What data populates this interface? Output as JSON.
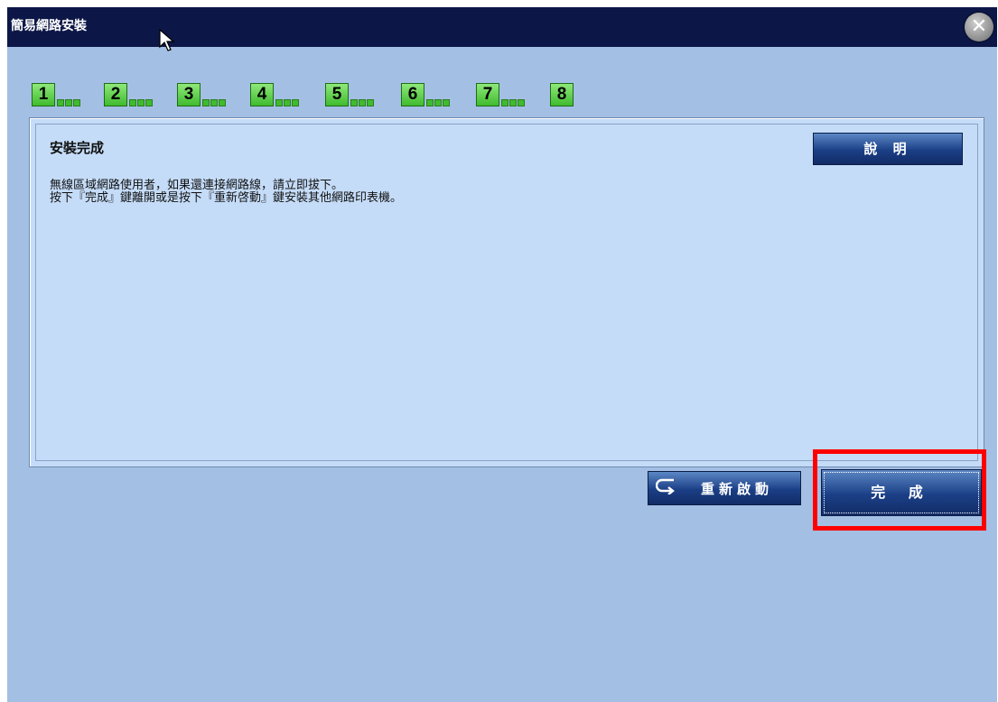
{
  "window": {
    "title": "簡易網路安裝",
    "close_icon": "close-icon"
  },
  "steps": [
    "1",
    "2",
    "3",
    "4",
    "5",
    "6",
    "7",
    "8"
  ],
  "panel": {
    "heading": "安裝完成",
    "help_label": "說 明",
    "message_line1": "無線區域網路使用者，如果還連接網路線，請立即拔下。",
    "message_line2": "按下『完成』鍵離開或是按下『重新啓動』鍵安裝其他網路印表機。"
  },
  "buttons": {
    "restart_label": "重新啟動",
    "finish_label": "完 成"
  },
  "colors": {
    "titlebar": "#0d1747",
    "window_bg": "#a3bfe4",
    "panel_bg": "#c5dcf8",
    "step_green": "#3fbb2e",
    "button_blue": "#1b3f86",
    "highlight": "#ff0000"
  }
}
